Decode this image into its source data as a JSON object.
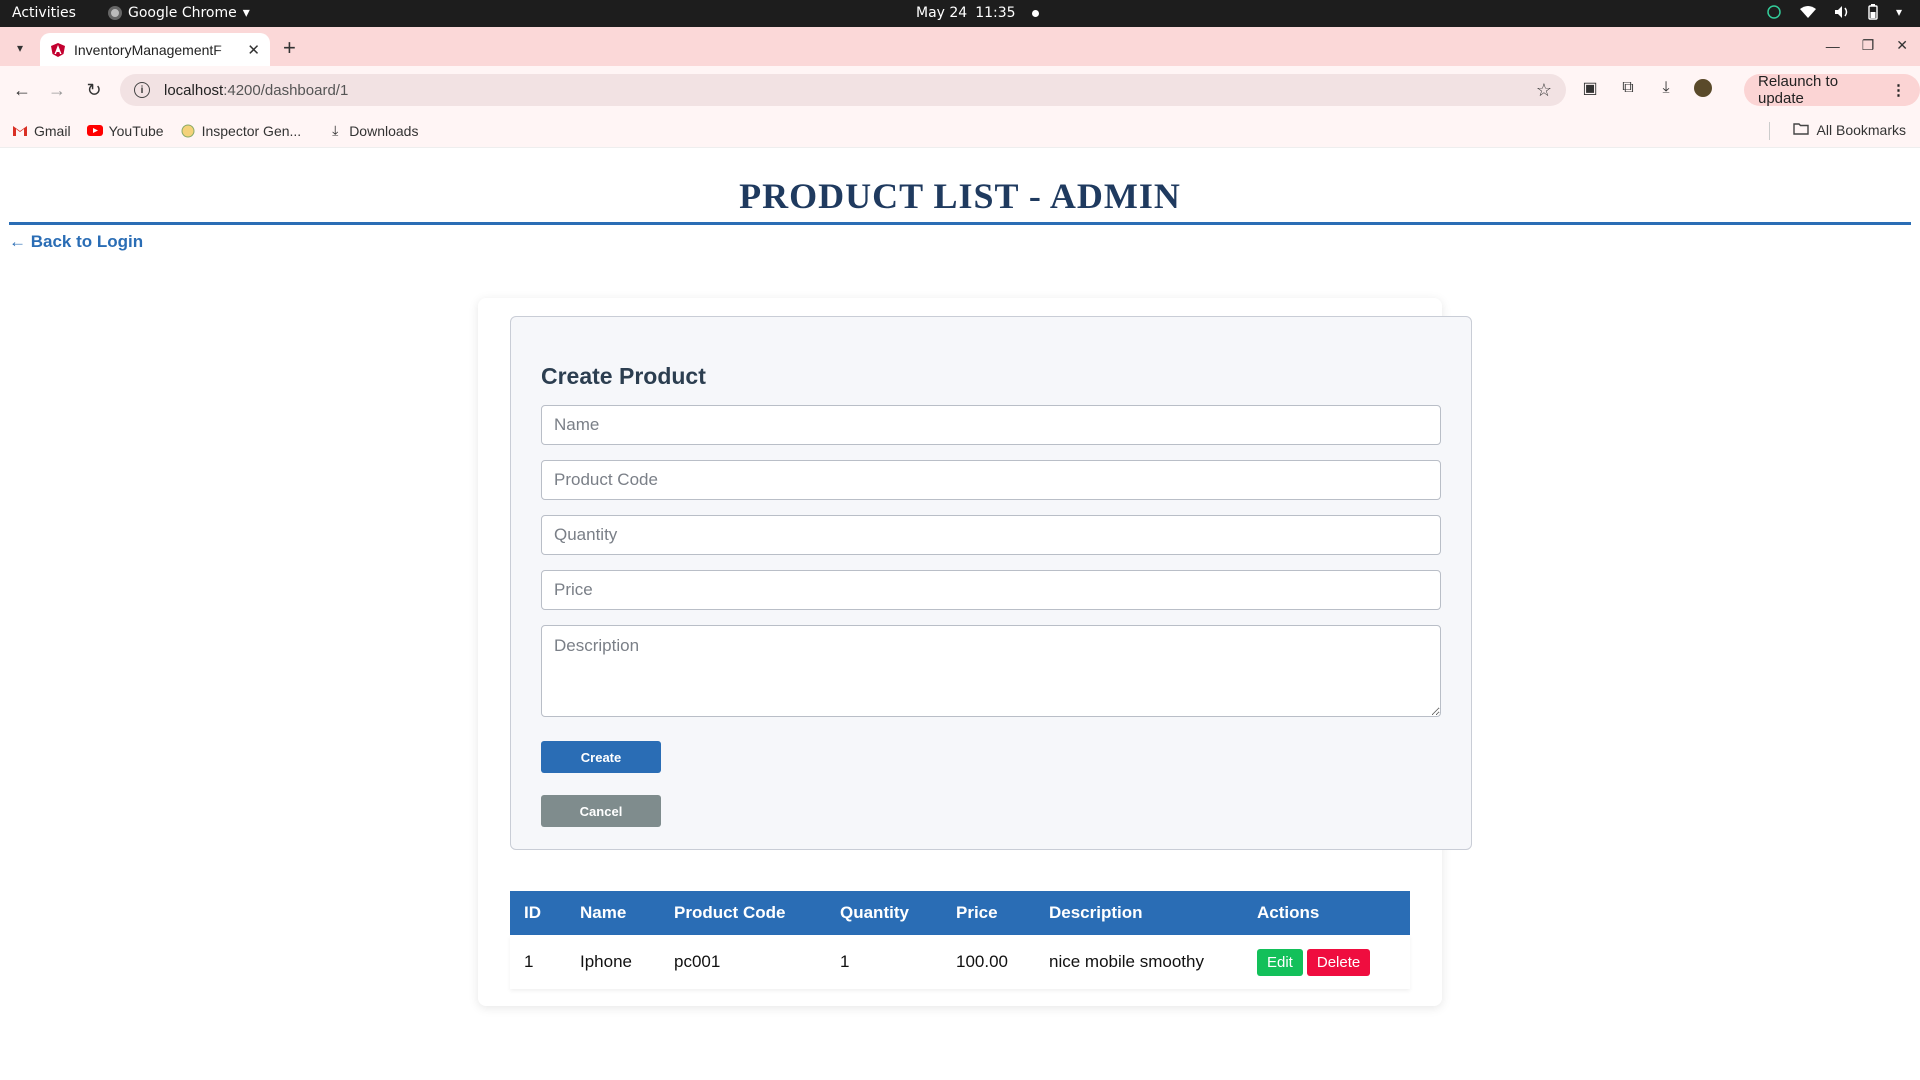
{
  "os_bar": {
    "activities": "Activities",
    "app_name": "Google Chrome",
    "date": "May 24",
    "time": "11:35",
    "tray_icons": [
      "accessibility-icon",
      "wifi-icon",
      "volume-icon",
      "battery-icon",
      "power-menu-icon"
    ]
  },
  "browser": {
    "tab_title": "InventoryManagementF",
    "url_host": "localhost",
    "url_path": ":4200/dashboard/1",
    "relaunch_label": "Relaunch to update",
    "bookmarks": [
      {
        "label": "Gmail",
        "icon": "gmail-icon"
      },
      {
        "label": "YouTube",
        "icon": "youtube-icon"
      },
      {
        "label": "Inspector Gen...",
        "icon": "inspector-icon"
      },
      {
        "label": "Downloads",
        "icon": "download-icon"
      }
    ],
    "all_bookmarks": "All Bookmarks"
  },
  "page": {
    "title": "PRODUCT LIST - ADMIN",
    "back_link": "← Back to Login",
    "form": {
      "heading": "Create Product",
      "name_placeholder": "Name",
      "code_placeholder": "Product Code",
      "quantity_placeholder": "Quantity",
      "price_placeholder": "Price",
      "description_placeholder": "Description",
      "create_label": "Create",
      "cancel_label": "Cancel"
    },
    "table": {
      "headers": [
        "ID",
        "Name",
        "Product Code",
        "Quantity",
        "Price",
        "Description",
        "Actions"
      ],
      "rows": [
        {
          "id": "1",
          "name": "Iphone",
          "code": "pc001",
          "quantity": "1",
          "price": "100.00",
          "description": "nice mobile smoothy"
        }
      ],
      "edit_label": "Edit",
      "delete_label": "Delete"
    }
  },
  "colors": {
    "accent": "#2a6db5",
    "title": "#1f3a5f",
    "edit": "#13c05a",
    "delete": "#ef0d3f",
    "cancel": "#7f8c8d",
    "tabstrip": "#fbd8d8"
  }
}
